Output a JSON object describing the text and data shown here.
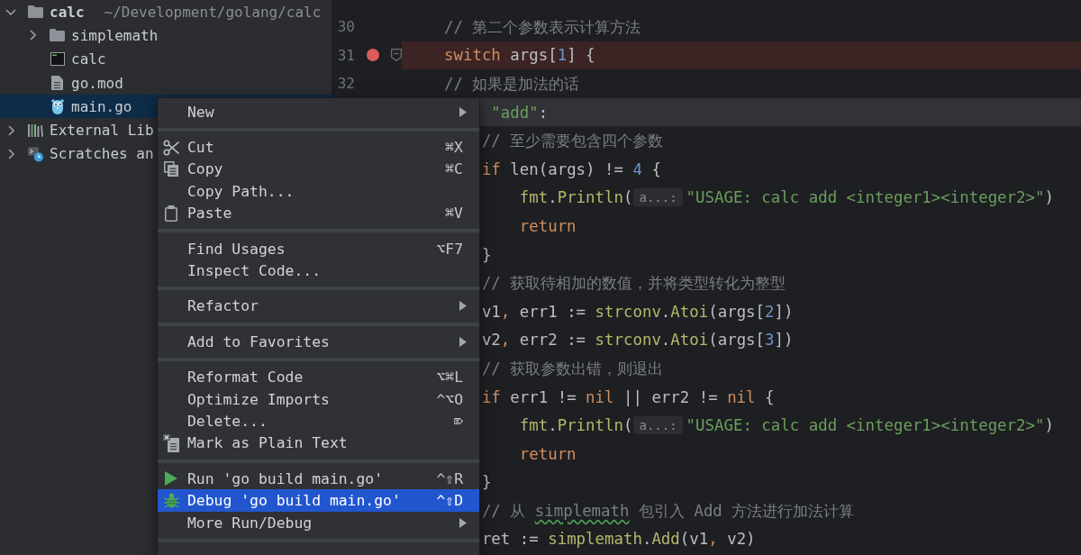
{
  "project_tree": {
    "items": [
      {
        "label": "calc",
        "kind": "module",
        "hint": "~/Development/golang/calc",
        "expanded": true,
        "selected": false,
        "children": [
          {
            "label": "simplemath",
            "kind": "folder",
            "expanded": false,
            "selected": false
          },
          {
            "label": "calc",
            "kind": "executable",
            "selected": false
          },
          {
            "label": "go.mod",
            "kind": "text-file",
            "selected": false
          },
          {
            "label": "main.go",
            "kind": "go-file",
            "selected": true
          }
        ]
      },
      {
        "label": "External Lib",
        "kind": "libraries",
        "expanded": false,
        "selected": false
      },
      {
        "label": "Scratches an",
        "kind": "scratches",
        "expanded": false,
        "selected": false
      }
    ]
  },
  "editor": {
    "lines": [
      {
        "number": "30",
        "breakpoint": false,
        "fold": false,
        "current": false,
        "tokens": [
          {
            "kind": "comment",
            "text": "// 第二个参数表示计算方法"
          }
        ]
      },
      {
        "number": "31",
        "breakpoint": true,
        "fold": true,
        "current": false,
        "tokens": [
          {
            "kind": "keyword",
            "text": "switch"
          },
          {
            "kind": "plain",
            "text": " args["
          },
          {
            "kind": "number",
            "text": "1"
          },
          {
            "kind": "plain",
            "text": "] {"
          }
        ]
      },
      {
        "number": "32",
        "breakpoint": false,
        "fold": false,
        "current": false,
        "tokens": [
          {
            "kind": "comment",
            "text": "// 如果是加法的话"
          }
        ]
      },
      {
        "breakpoint": false,
        "fold": false,
        "current": true,
        "tokens": [
          {
            "kind": "string",
            "text": "     \"add\""
          },
          {
            "kind": "plain",
            "text": ":"
          }
        ]
      },
      {
        "breakpoint": false,
        "fold": false,
        "current": false,
        "tokens": [
          {
            "kind": "comment",
            "text": "    // 至少需要包含四个参数"
          }
        ]
      },
      {
        "breakpoint": false,
        "fold": false,
        "current": false,
        "tokens": [
          {
            "kind": "keyword",
            "text": "    if"
          },
          {
            "kind": "plain",
            "text": " len(args) != "
          },
          {
            "kind": "number",
            "text": "4"
          },
          {
            "kind": "plain",
            "text": " {"
          }
        ]
      },
      {
        "breakpoint": false,
        "fold": false,
        "current": false,
        "tokens": [
          {
            "kind": "call",
            "text": "        fmt"
          },
          {
            "kind": "plain",
            "text": "."
          },
          {
            "kind": "call",
            "text": "Println"
          },
          {
            "kind": "plain",
            "text": "("
          },
          {
            "kind": "hint",
            "text": "a...:"
          },
          {
            "kind": "string",
            "text": "\"USAGE: calc add <integer1><integer2>\""
          },
          {
            "kind": "plain",
            "text": ")"
          }
        ]
      },
      {
        "breakpoint": false,
        "fold": false,
        "current": false,
        "tokens": [
          {
            "kind": "keyword",
            "text": "        return"
          }
        ]
      },
      {
        "breakpoint": false,
        "fold": false,
        "current": false,
        "tokens": [
          {
            "kind": "plain",
            "text": "    }"
          }
        ]
      },
      {
        "breakpoint": false,
        "fold": false,
        "current": false,
        "tokens": [
          {
            "kind": "comment",
            "text": "    // 获取待相加的数值，并将类型转化为整型"
          }
        ]
      },
      {
        "breakpoint": false,
        "fold": false,
        "current": false,
        "tokens": [
          {
            "kind": "plain",
            "text": "    v1"
          },
          {
            "kind": "separator",
            "text": ","
          },
          {
            "kind": "plain",
            "text": " err1 := "
          },
          {
            "kind": "call",
            "text": "strconv"
          },
          {
            "kind": "plain",
            "text": "."
          },
          {
            "kind": "call",
            "text": "Atoi"
          },
          {
            "kind": "plain",
            "text": "(args["
          },
          {
            "kind": "number",
            "text": "2"
          },
          {
            "kind": "plain",
            "text": "])"
          }
        ]
      },
      {
        "breakpoint": false,
        "fold": false,
        "current": false,
        "tokens": [
          {
            "kind": "plain",
            "text": "    v2"
          },
          {
            "kind": "separator",
            "text": ","
          },
          {
            "kind": "plain",
            "text": " err2 := "
          },
          {
            "kind": "call",
            "text": "strconv"
          },
          {
            "kind": "plain",
            "text": "."
          },
          {
            "kind": "call",
            "text": "Atoi"
          },
          {
            "kind": "plain",
            "text": "(args["
          },
          {
            "kind": "number",
            "text": "3"
          },
          {
            "kind": "plain",
            "text": "])"
          }
        ]
      },
      {
        "breakpoint": false,
        "fold": false,
        "current": false,
        "tokens": [
          {
            "kind": "comment",
            "text": "    // 获取参数出错，则退出"
          }
        ]
      },
      {
        "breakpoint": false,
        "fold": false,
        "current": false,
        "tokens": [
          {
            "kind": "keyword",
            "text": "    if"
          },
          {
            "kind": "plain",
            "text": " err1 != "
          },
          {
            "kind": "keyword",
            "text": "nil"
          },
          {
            "kind": "plain",
            "text": " || err2 != "
          },
          {
            "kind": "keyword",
            "text": "nil"
          },
          {
            "kind": "plain",
            "text": " {"
          }
        ]
      },
      {
        "breakpoint": false,
        "fold": false,
        "current": false,
        "tokens": [
          {
            "kind": "call",
            "text": "        fmt"
          },
          {
            "kind": "plain",
            "text": "."
          },
          {
            "kind": "call",
            "text": "Println"
          },
          {
            "kind": "plain",
            "text": "("
          },
          {
            "kind": "hint",
            "text": "a...:"
          },
          {
            "kind": "string",
            "text": "\"USAGE: calc add <integer1><integer2>\""
          },
          {
            "kind": "plain",
            "text": ")"
          }
        ]
      },
      {
        "breakpoint": false,
        "fold": false,
        "current": false,
        "tokens": [
          {
            "kind": "keyword",
            "text": "        return"
          }
        ]
      },
      {
        "breakpoint": false,
        "fold": false,
        "current": false,
        "tokens": [
          {
            "kind": "plain",
            "text": "    }"
          }
        ]
      },
      {
        "breakpoint": false,
        "fold": false,
        "current": false,
        "tokens": [
          {
            "kind": "comment",
            "text": "    // 从 "
          },
          {
            "kind": "typo",
            "text": "simplemath"
          },
          {
            "kind": "comment",
            "text": " 包引入 Add 方法进行加法计算"
          }
        ]
      },
      {
        "breakpoint": false,
        "fold": false,
        "current": false,
        "tokens": [
          {
            "kind": "plain",
            "text": "    ret := "
          },
          {
            "kind": "call",
            "text": "simplemath"
          },
          {
            "kind": "plain",
            "text": "."
          },
          {
            "kind": "call",
            "text": "Add"
          },
          {
            "kind": "plain",
            "text": "(v1"
          },
          {
            "kind": "separator",
            "text": ","
          },
          {
            "kind": "plain",
            "text": " v2)"
          }
        ]
      }
    ]
  },
  "context_menu": {
    "groups": [
      {
        "items": [
          {
            "label": "New",
            "kind": "plain",
            "submenu": true,
            "selected": false
          }
        ]
      },
      {
        "items": [
          {
            "label": "Cut",
            "kind": "cut",
            "shortcut": "⌘X",
            "submenu": false,
            "selected": false
          },
          {
            "label": "Copy",
            "kind": "copy",
            "shortcut": "⌘C",
            "submenu": false,
            "selected": false
          },
          {
            "label": "Copy Path...",
            "kind": "plain",
            "submenu": false,
            "selected": false
          },
          {
            "label": "Paste",
            "kind": "paste",
            "shortcut": "⌘V",
            "submenu": false,
            "selected": false
          }
        ]
      },
      {
        "items": [
          {
            "label": "Find Usages",
            "kind": "plain",
            "shortcut": "⌥F7",
            "submenu": false,
            "selected": false
          },
          {
            "label": "Inspect Code...",
            "kind": "plain",
            "submenu": false,
            "selected": false
          }
        ]
      },
      {
        "items": [
          {
            "label": "Refactor",
            "kind": "plain",
            "submenu": true,
            "selected": false
          }
        ]
      },
      {
        "items": [
          {
            "label": "Add to Favorites",
            "kind": "plain",
            "submenu": true,
            "selected": false
          }
        ]
      },
      {
        "items": [
          {
            "label": "Reformat Code",
            "kind": "plain",
            "shortcut": "⌥⌘L",
            "submenu": false,
            "selected": false
          },
          {
            "label": "Optimize Imports",
            "kind": "plain",
            "shortcut": "^⌥O",
            "submenu": false,
            "selected": false
          },
          {
            "label": "Delete...",
            "kind": "plain",
            "shortcut": "⌦",
            "submenu": false,
            "selected": false
          },
          {
            "label": "Mark as Plain Text",
            "kind": "mark",
            "submenu": false,
            "selected": false
          }
        ]
      },
      {
        "items": [
          {
            "label": "Run 'go build main.go'",
            "kind": "run",
            "shortcut": "^⇧R",
            "submenu": false,
            "selected": false
          },
          {
            "label": "Debug 'go build main.go'",
            "kind": "debug",
            "shortcut": "^⇧D",
            "submenu": false,
            "selected": true
          },
          {
            "label": "More Run/Debug",
            "kind": "plain",
            "submenu": true,
            "selected": false
          }
        ]
      }
    ]
  }
}
